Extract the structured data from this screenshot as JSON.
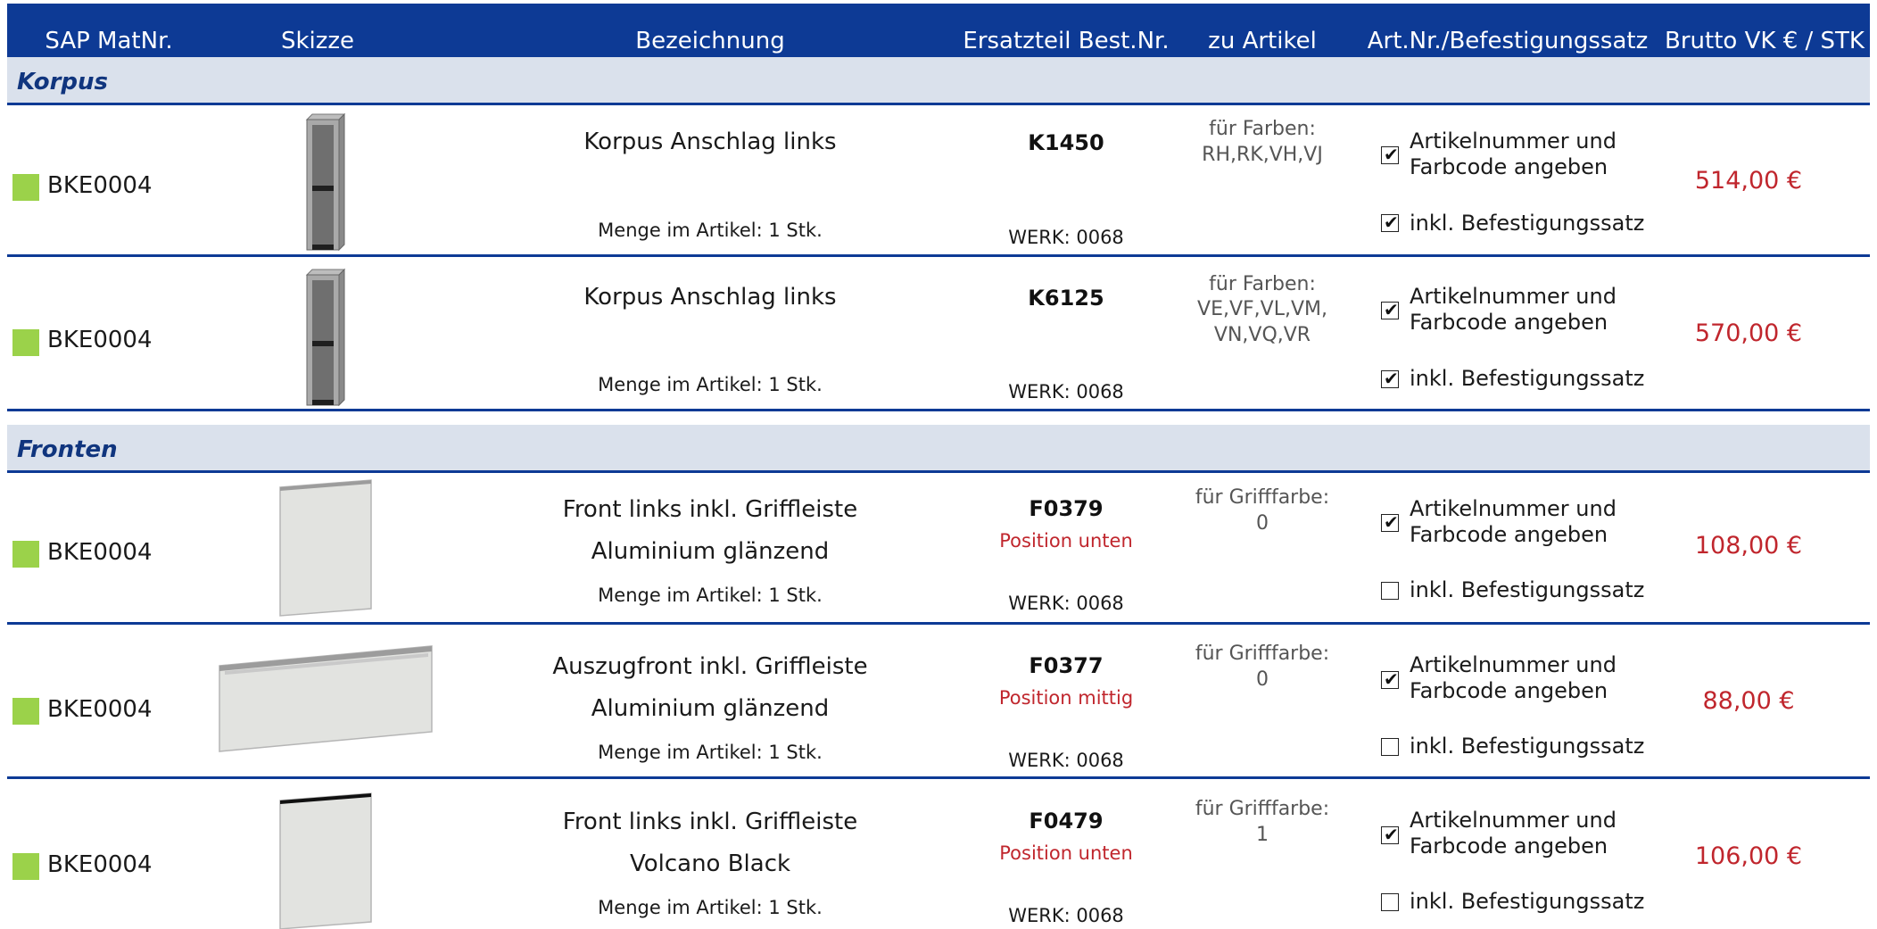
{
  "header": {
    "sap": "SAP MatNr.",
    "skizze": "Skizze",
    "bezeichnung": "Bezeichnung",
    "ersatzteil": "Ersatzteil Best.Nr.",
    "zu_artikel": "zu Artikel",
    "artnr": "Art.Nr./Befestigungssatz",
    "brutto": "Brutto VK € / STK"
  },
  "sections": {
    "korpus": "Korpus",
    "fronten": "Fronten"
  },
  "rows": [
    {
      "matnr": "BKE0004",
      "name1": "Korpus Anschlag links",
      "name2": "",
      "qty": "Menge im Artikel: 1 Stk.",
      "part": "K1450",
      "position": "",
      "werk": "WERK: 0068",
      "zu1": "für Farben:",
      "zu2": "RH,RK,VH,VJ",
      "zu3": "",
      "cb1_label1": "Artikelnummer und",
      "cb1_label2": "Farbcode angeben",
      "cb1_checked": true,
      "cb2_label": "inkl. Befestigungssatz",
      "cb2_checked": true,
      "price": "514,00 €",
      "sketch": "korpus"
    },
    {
      "matnr": "BKE0004",
      "name1": "Korpus Anschlag links",
      "name2": "",
      "qty": "Menge im Artikel: 1 Stk.",
      "part": "K6125",
      "position": "",
      "werk": "WERK: 0068",
      "zu1": "für Farben:",
      "zu2": "VE,VF,VL,VM,",
      "zu3": "VN,VQ,VR",
      "cb1_label1": "Artikelnummer und",
      "cb1_label2": "Farbcode angeben",
      "cb1_checked": true,
      "cb2_label": "inkl. Befestigungssatz",
      "cb2_checked": true,
      "price": "570,00 €",
      "sketch": "korpus"
    },
    {
      "matnr": "BKE0004",
      "name1": "Front links inkl. Griffleiste",
      "name2": "Aluminium glänzend",
      "qty": "Menge im Artikel: 1 Stk.",
      "part": "F0379",
      "position": "Position unten",
      "werk": "WERK: 0068",
      "zu1": "für Grifffarbe:",
      "zu2": "0",
      "zu3": "",
      "cb1_label1": "Artikelnummer und",
      "cb1_label2": "Farbcode angeben",
      "cb1_checked": true,
      "cb2_label": "inkl. Befestigungssatz",
      "cb2_checked": false,
      "price": "108,00 €",
      "sketch": "front-tall-alu"
    },
    {
      "matnr": "BKE0004",
      "name1": "Auszugfront inkl. Griffleiste",
      "name2": "Aluminium glänzend",
      "qty": "Menge im Artikel: 1 Stk.",
      "part": "F0377",
      "position": "Position mittig",
      "werk": "WERK: 0068",
      "zu1": "für Grifffarbe:",
      "zu2": "0",
      "zu3": "",
      "cb1_label1": "Artikelnummer und",
      "cb1_label2": "Farbcode angeben",
      "cb1_checked": true,
      "cb2_label": "inkl. Befestigungssatz",
      "cb2_checked": false,
      "price": "88,00 €",
      "sketch": "front-wide-alu"
    },
    {
      "matnr": "BKE0004",
      "name1": "Front links inkl. Griffleiste",
      "name2": "Volcano Black",
      "qty": "Menge im Artikel: 1 Stk.",
      "part": "F0479",
      "position": "Position unten",
      "werk": "WERK: 0068",
      "zu1": "für Grifffarbe:",
      "zu2": "1",
      "zu3": "",
      "cb1_label1": "Artikelnummer und",
      "cb1_label2": "Farbcode angeben",
      "cb1_checked": true,
      "cb2_label": "inkl. Befestigungssatz",
      "cb2_checked": false,
      "price": "106,00 €",
      "sketch": "front-tall-black"
    }
  ],
  "colors": {
    "header_bg": "#0d3a95",
    "section_bg": "#dae1ec",
    "price": "#c0262d",
    "status_square": "#9bd24a"
  }
}
